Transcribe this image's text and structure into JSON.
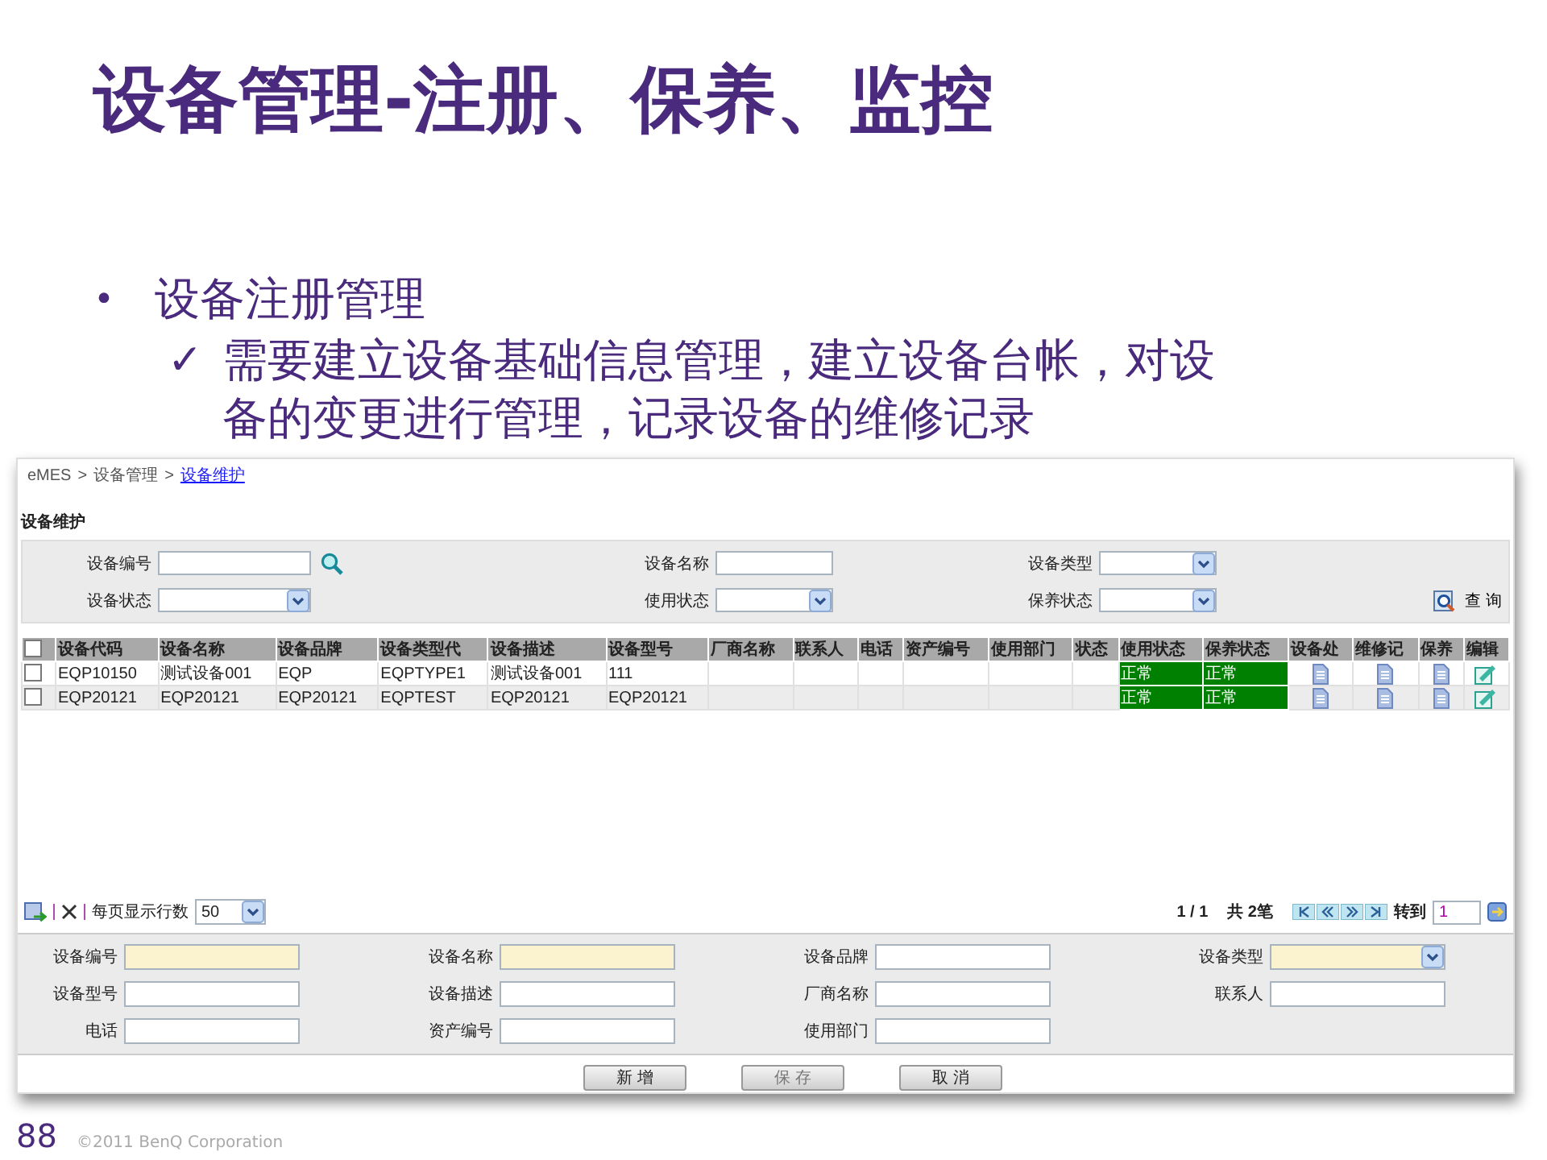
{
  "slide": {
    "title": "设备管理-注册、保养、监控",
    "bullet_marker": "•",
    "bullet": "设备注册管理",
    "sub_bullets": [
      {
        "mark": "✓",
        "text": "需要建立设备基础信息管理，建立设备台帐，对设"
      },
      {
        "text": "备的变更进行管理，记录设备的维修记录"
      }
    ],
    "page_number": "88",
    "copyright": "©2011 BenQ Corporation"
  },
  "breadcrumb": [
    {
      "kind": "text",
      "text": "eMES"
    },
    {
      "kind": "sep",
      "text": ">"
    },
    {
      "kind": "text",
      "text": "设备管理"
    },
    {
      "kind": "sep",
      "text": ">"
    },
    {
      "kind": "link",
      "text": "设备维护"
    }
  ],
  "page_title": "设备维护",
  "search_form": {
    "fields": [
      {
        "label": "设备编号",
        "kind": "lookup"
      },
      {
        "label": "设备名称",
        "kind": "text"
      },
      {
        "label": "设备类型",
        "kind": "select"
      },
      {
        "label": "设备状态",
        "kind": "select"
      },
      {
        "label": "使用状态",
        "kind": "select"
      },
      {
        "label": "保养状态",
        "kind": "select"
      }
    ],
    "query_button": "查 询"
  },
  "table": {
    "all_checked": false,
    "columns": [
      "设备代码",
      "设备名称",
      "设备品牌",
      "设备类型代",
      "设备描述",
      "设备型号",
      "厂商名称",
      "联系人",
      "电话",
      "资产编号",
      "使用部门",
      "状态",
      "使用状态",
      "保养状态",
      "设备处",
      "维修记",
      "保养",
      "编辑"
    ],
    "rows": [
      {
        "checked": false,
        "cells": [
          {
            "kind": "text",
            "text": "EQP10150"
          },
          {
            "kind": "text",
            "text": "测试设备001"
          },
          {
            "kind": "text",
            "text": "EQP"
          },
          {
            "kind": "text",
            "text": "EQPTYPE1"
          },
          {
            "kind": "text",
            "text": "测试设备001"
          },
          {
            "kind": "text",
            "text": "111"
          },
          {
            "kind": "text",
            "text": ""
          },
          {
            "kind": "text",
            "text": ""
          },
          {
            "kind": "text",
            "text": ""
          },
          {
            "kind": "text",
            "text": ""
          },
          {
            "kind": "text",
            "text": ""
          },
          {
            "kind": "text",
            "text": ""
          },
          {
            "kind": "status",
            "text": "正常",
            "color": "#008000"
          },
          {
            "kind": "status",
            "text": "正常",
            "color": "#008000"
          },
          {
            "kind": "doc"
          },
          {
            "kind": "doc"
          },
          {
            "kind": "doc"
          },
          {
            "kind": "edit"
          }
        ]
      },
      {
        "checked": false,
        "cells": [
          {
            "kind": "text",
            "text": "EQP20121"
          },
          {
            "kind": "text",
            "text": "EQP20121"
          },
          {
            "kind": "text",
            "text": "EQP20121"
          },
          {
            "kind": "text",
            "text": "EQPTEST"
          },
          {
            "kind": "text",
            "text": "EQP20121"
          },
          {
            "kind": "text",
            "text": "EQP20121"
          },
          {
            "kind": "text",
            "text": ""
          },
          {
            "kind": "text",
            "text": ""
          },
          {
            "kind": "text",
            "text": ""
          },
          {
            "kind": "text",
            "text": ""
          },
          {
            "kind": "text",
            "text": ""
          },
          {
            "kind": "text",
            "text": ""
          },
          {
            "kind": "status",
            "text": "正常",
            "color": "#008000"
          },
          {
            "kind": "status",
            "text": "正常",
            "color": "#008000"
          },
          {
            "kind": "doc"
          },
          {
            "kind": "doc"
          },
          {
            "kind": "doc"
          },
          {
            "kind": "edit"
          }
        ]
      }
    ]
  },
  "pager": {
    "rows_per_page_label": "每页显示行数",
    "rows_per_page": "50",
    "page": "1 / 1",
    "total": "共 2笔",
    "goto_label": "转到",
    "goto_value": "1"
  },
  "edit_form": {
    "fields": [
      {
        "label": "设备编号",
        "kind": "text",
        "required": true
      },
      {
        "label": "设备名称",
        "kind": "text",
        "required": true
      },
      {
        "label": "设备品牌",
        "kind": "text",
        "required": false
      },
      {
        "label": "设备类型",
        "kind": "select",
        "required": true
      },
      {
        "label": "设备型号",
        "kind": "text",
        "required": false
      },
      {
        "label": "设备描述",
        "kind": "text",
        "required": false
      },
      {
        "label": "厂商名称",
        "kind": "text",
        "required": false
      },
      {
        "label": "联系人",
        "kind": "text",
        "required": false
      },
      {
        "label": "电话",
        "kind": "text",
        "required": false
      },
      {
        "label": "资产编号",
        "kind": "text",
        "required": false
      },
      {
        "label": "使用部门",
        "kind": "text",
        "required": false
      }
    ],
    "buttons": [
      {
        "label": "新 增",
        "disabled": false
      },
      {
        "label": "保 存",
        "disabled": true
      },
      {
        "label": "取 消",
        "disabled": false
      }
    ]
  }
}
